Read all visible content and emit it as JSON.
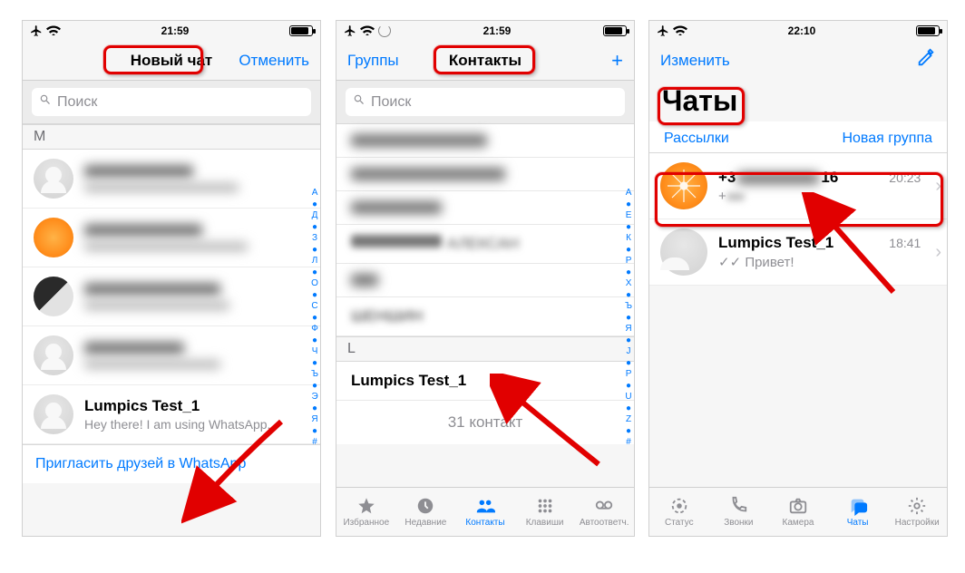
{
  "status": {
    "time1": "21:59",
    "time2": "21:59",
    "time3": "22:10"
  },
  "phone1": {
    "nav_title": "Новый чат",
    "nav_right": "Отменить",
    "search_placeholder": "Поиск",
    "section_m": "М",
    "contact_lumpics_name": "Lumpics Test_1",
    "contact_lumpics_status": "Hey there! I am using WhatsApp.",
    "invite_label": "Пригласить друзей в WhatsApp",
    "index_letters": [
      "А",
      "●",
      "Д",
      "●",
      "З",
      "●",
      "Л",
      "●",
      "О",
      "●",
      "С",
      "●",
      "Ф",
      "●",
      "Ч",
      "●",
      "Ъ",
      "●",
      "Э",
      "●",
      "Я",
      "●",
      "#"
    ]
  },
  "phone2": {
    "nav_left": "Группы",
    "nav_title": "Контакты",
    "nav_right": "+",
    "search_placeholder": "Поиск",
    "section_l": "L",
    "contact_lumpics": "Lumpics Test_1",
    "count_text": "31 контакт",
    "index_letters": [
      "А",
      "●",
      "Е",
      "●",
      "К",
      "●",
      "Р",
      "●",
      "Х",
      "●",
      "Ъ",
      "●",
      "Я",
      "●",
      "J",
      "●",
      "P",
      "●",
      "U",
      "●",
      "Z",
      "●",
      "#"
    ],
    "tabs": {
      "fav": "Избранное",
      "recent": "Недавние",
      "contacts": "Контакты",
      "keypad": "Клавиши",
      "voicemail": "Автоответч."
    }
  },
  "phone3": {
    "nav_left": "Изменить",
    "big_title": "Чаты",
    "link_left": "Рассылки",
    "link_right": "Новая группа",
    "chat1": {
      "name_prefix": "+3",
      "name_suffix": "16",
      "time": "20:23",
      "msg": "+"
    },
    "chat2": {
      "name": "Lumpics Test_1",
      "time": "18:41",
      "msg": "Привет!"
    },
    "tabs": {
      "status": "Статус",
      "calls": "Звонки",
      "camera": "Камера",
      "chats": "Чаты",
      "settings": "Настройки"
    }
  }
}
